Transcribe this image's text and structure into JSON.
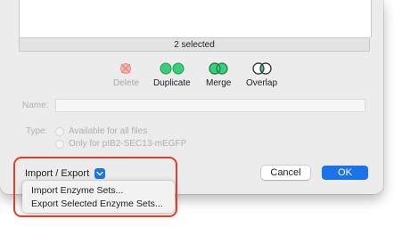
{
  "status": {
    "selection_text": "2 selected"
  },
  "toolbar": {
    "tools": [
      {
        "label": "Delete",
        "icon": "delete-icon",
        "enabled": false
      },
      {
        "label": "Duplicate",
        "icon": "duplicate-icon",
        "enabled": true
      },
      {
        "label": "Merge",
        "icon": "merge-icon",
        "enabled": true
      },
      {
        "label": "Overlap",
        "icon": "overlap-icon",
        "enabled": true
      }
    ]
  },
  "form": {
    "name_label": "Name:",
    "name_value": "",
    "type_label": "Type:",
    "type_options": [
      "Available for all files",
      "Only for pIB2-SEC13-mEGFP"
    ]
  },
  "buttons": {
    "import_export_label": "Import / Export",
    "cancel_label": "Cancel",
    "ok_label": "OK"
  },
  "menu": {
    "items": [
      "Import Enzyme Sets...",
      "Export Selected Enzyme Sets..."
    ]
  },
  "colors": {
    "accent": "#1a73e8",
    "highlight": "#e0402a",
    "green_circle": "#2ecc71",
    "delete_red": "#e74c3c"
  }
}
